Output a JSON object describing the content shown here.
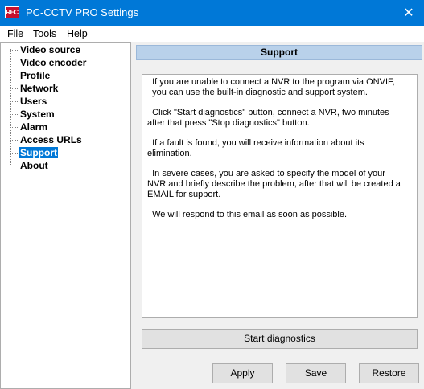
{
  "window": {
    "icon_text": "REC",
    "title": "PC-CCTV PRO Settings",
    "close_glyph": "✕"
  },
  "menu": [
    "File",
    "Tools",
    "Help"
  ],
  "tree": {
    "items": [
      "Video source",
      "Video encoder",
      "Profile",
      "Network",
      "Users",
      "System",
      "Alarm",
      "Access URLs",
      "Support",
      "About"
    ],
    "selected": "Support"
  },
  "panel": {
    "title": "Support",
    "paragraphs": [
      "  If you are unable to connect a NVR to the program via ONVIF,\n  you can use the built-in diagnostic and support system.",
      "  Click \"Start diagnostics\" button, connect a NVR, two minutes\nafter that press \"Stop diagnostics\" button.",
      "  If a fault is found, you will receive information about its\nelimination.",
      "  In severe cases, you are asked to specify the model of your\nNVR and briefly describe the problem, after that will be created a\nEMAIL for support.",
      "  We will respond to this email as soon as possible."
    ]
  },
  "buttons": {
    "diagnostics": "Start diagnostics",
    "apply": "Apply",
    "save": "Save",
    "restore": "Restore"
  },
  "colors": {
    "titlebar": "#0078d7",
    "selection": "#0078d7",
    "panel_header": "#b9d1ea"
  }
}
